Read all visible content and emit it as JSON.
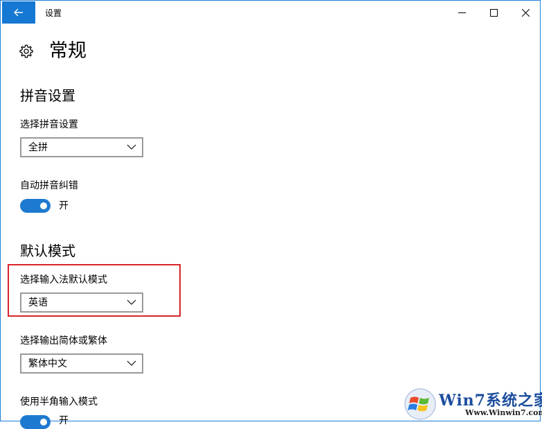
{
  "window": {
    "title": "设置",
    "controls": [
      "minimize",
      "maximize",
      "close"
    ]
  },
  "page": {
    "title": "常规",
    "icon": "gear-icon"
  },
  "pinyin_section": {
    "title": "拼音设置",
    "select_label": "选择拼音设置",
    "select_value": "全拼",
    "autocorrect_label": "自动拼音纠错",
    "autocorrect_state": "开",
    "autocorrect_on": true
  },
  "default_mode_section": {
    "title": "默认模式",
    "input_mode_label": "选择输入法默认模式",
    "input_mode_value": "英语",
    "output_label": "选择输出简体或繁体",
    "output_value": "繁体中文",
    "halfwidth_label": "使用半角输入模式",
    "halfwidth_state": "开",
    "halfwidth_on": true
  },
  "watermark": {
    "main": "Win7系统之家",
    "url": "Www.Winwin7.com"
  },
  "colors": {
    "accent": "#1578d2",
    "highlight_border": "#d9232a",
    "dropdown_border": "#999999"
  }
}
